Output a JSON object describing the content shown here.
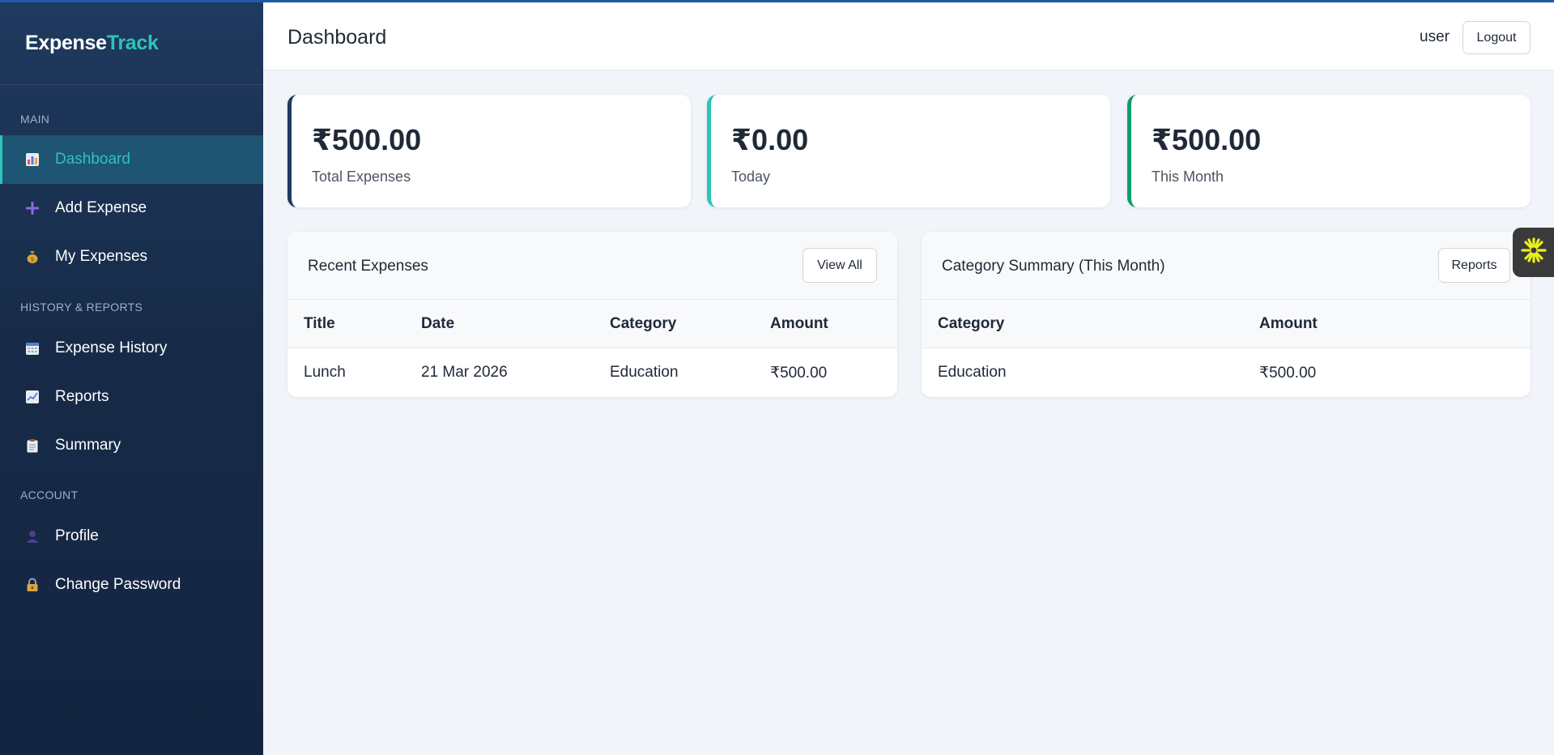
{
  "brand": {
    "part1": "Expense",
    "part2": "Track"
  },
  "sidebar": {
    "sections": [
      {
        "label": "MAIN"
      },
      {
        "label": "HISTORY & REPORTS"
      },
      {
        "label": "ACCOUNT"
      }
    ],
    "items": [
      {
        "label": "Dashboard",
        "icon": "bar-chart-icon",
        "active": true
      },
      {
        "label": "Add Expense",
        "icon": "plus-icon"
      },
      {
        "label": "My Expenses",
        "icon": "money-bag-icon"
      },
      {
        "label": "Expense History",
        "icon": "calendar-icon"
      },
      {
        "label": "Reports",
        "icon": "line-chart-icon"
      },
      {
        "label": "Summary",
        "icon": "clipboard-icon"
      },
      {
        "label": "Profile",
        "icon": "user-icon"
      },
      {
        "label": "Change Password",
        "icon": "lock-icon"
      }
    ]
  },
  "header": {
    "title": "Dashboard",
    "user": "user",
    "logout_label": "Logout"
  },
  "stats": [
    {
      "value": "₹500.00",
      "label": "Total Expenses",
      "accent": "#1f3a5f"
    },
    {
      "value": "₹0.00",
      "label": "Today",
      "accent": "#2ec4b6"
    },
    {
      "value": "₹500.00",
      "label": "This Month",
      "accent": "#0f9d6e"
    }
  ],
  "recent": {
    "title": "Recent Expenses",
    "button_label": "View All",
    "columns": [
      "Title",
      "Date",
      "Category",
      "Amount"
    ],
    "rows": [
      [
        "Lunch",
        "21 Mar 2026",
        "Education",
        "₹500.00"
      ]
    ]
  },
  "category_summary": {
    "title": "Category Summary (This Month)",
    "button_label": "Reports",
    "columns": [
      "Category",
      "Amount"
    ],
    "rows": [
      [
        "Education",
        "₹500.00"
      ]
    ]
  },
  "colors": {
    "accent": "#2ec4b6",
    "sidebar": "#1f3a5f"
  },
  "widget": {
    "icon": "asterisk-icon"
  }
}
